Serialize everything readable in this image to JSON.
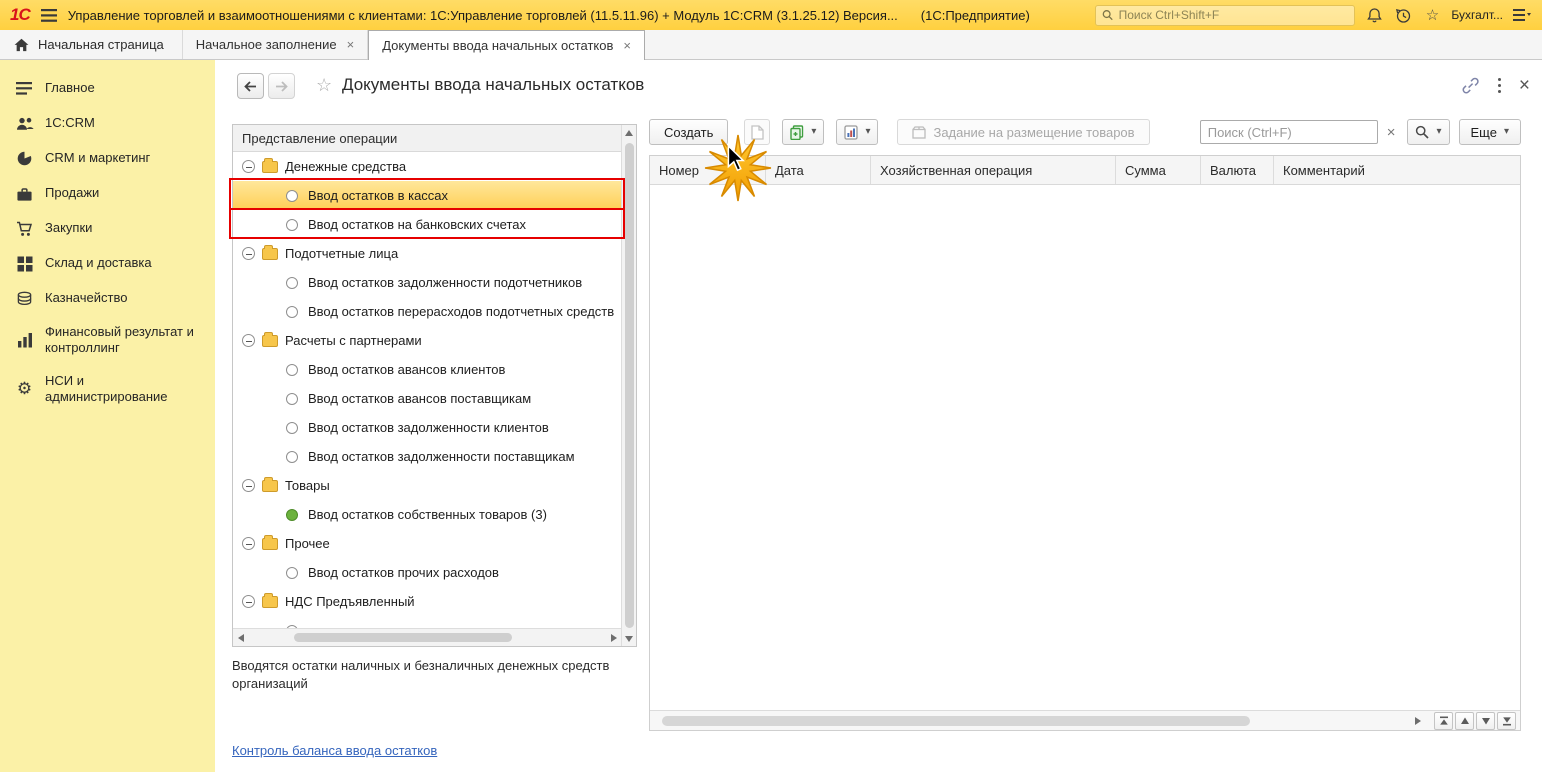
{
  "colors": {
    "topbar": "#FFD03F",
    "topbar-light": "#FFDC66",
    "sidebar": "#FBF1A7",
    "annotation": "#E60000",
    "link": "#3565BD",
    "green": "#6CB23E",
    "selection1": "#FFE79B",
    "selection2": "#FFCF55",
    "star": "#F7A600"
  },
  "icons": {
    "caret": "▾",
    "close": "×",
    "clear": "×",
    "star": "☆",
    "fav_star": "☆",
    "gear": "⚙"
  },
  "topbar": {
    "logo": "1С",
    "title": "Управление торговлей и взаимоотношениями с клиентами: 1С:Управление торговлей (11.5.11.96) + Модуль 1С:CRM (3.1.25.12) Версия...",
    "app_name": "(1С:Предприятие)",
    "search_placeholder": "Поиск Ctrl+Shift+F",
    "user": "Бухгалт..."
  },
  "tabbar": {
    "home": "Начальная страница",
    "tabs": [
      {
        "label": "Начальное заполнение",
        "active": false
      },
      {
        "label": "Документы ввода начальных остатков",
        "active": true
      }
    ]
  },
  "sidebar": {
    "items": [
      "Главное",
      "1С:CRM",
      "CRM и маркетинг",
      "Продажи",
      "Закупки",
      "Склад и доставка",
      "Казначейство",
      "Финансовый результат и контроллинг",
      "НСИ и администрирование"
    ]
  },
  "page": {
    "title": "Документы ввода начальных остатков",
    "description": "Вводятся остатки наличных и безналичных денежных средств организаций",
    "footer_link": "Контроль баланса ввода остатков"
  },
  "tree": {
    "header": "Представление операции",
    "items": [
      {
        "type": "group",
        "label": "Денежные средства"
      },
      {
        "type": "item",
        "label": "Ввод остатков в кассах",
        "selected": true
      },
      {
        "type": "item",
        "label": "Ввод остатков на банковских счетах"
      },
      {
        "type": "group",
        "label": "Подотчетные лица"
      },
      {
        "type": "item",
        "label": "Ввод остатков задолженности подотчетников"
      },
      {
        "type": "item",
        "label": "Ввод остатков перерасходов подотчетных средств"
      },
      {
        "type": "group",
        "label": "Расчеты с партнерами"
      },
      {
        "type": "item",
        "label": "Ввод остатков авансов клиентов"
      },
      {
        "type": "item",
        "label": "Ввод остатков авансов поставщикам"
      },
      {
        "type": "item",
        "label": "Ввод остатков задолженности клиентов"
      },
      {
        "type": "item",
        "label": "Ввод остатков задолженности поставщикам"
      },
      {
        "type": "group",
        "label": "Товары"
      },
      {
        "type": "item",
        "label": "Ввод остатков собственных товаров (3)",
        "status": "green"
      },
      {
        "type": "group",
        "label": "Прочее"
      },
      {
        "type": "item",
        "label": "Ввод остатков прочих расходов"
      },
      {
        "type": "group",
        "label": "НДС Предъявленный"
      },
      {
        "type": "item",
        "label": ""
      }
    ]
  },
  "toolbar": {
    "create": "Создать",
    "placement_task": "Задание на размещение товаров",
    "search_placeholder": "Поиск (Ctrl+F)",
    "more": "Еще"
  },
  "grid": {
    "columns": [
      "Номер",
      "Дата",
      "Хозяйственная операция",
      "Сумма",
      "Валюта",
      "Комментарий"
    ],
    "rows": []
  }
}
